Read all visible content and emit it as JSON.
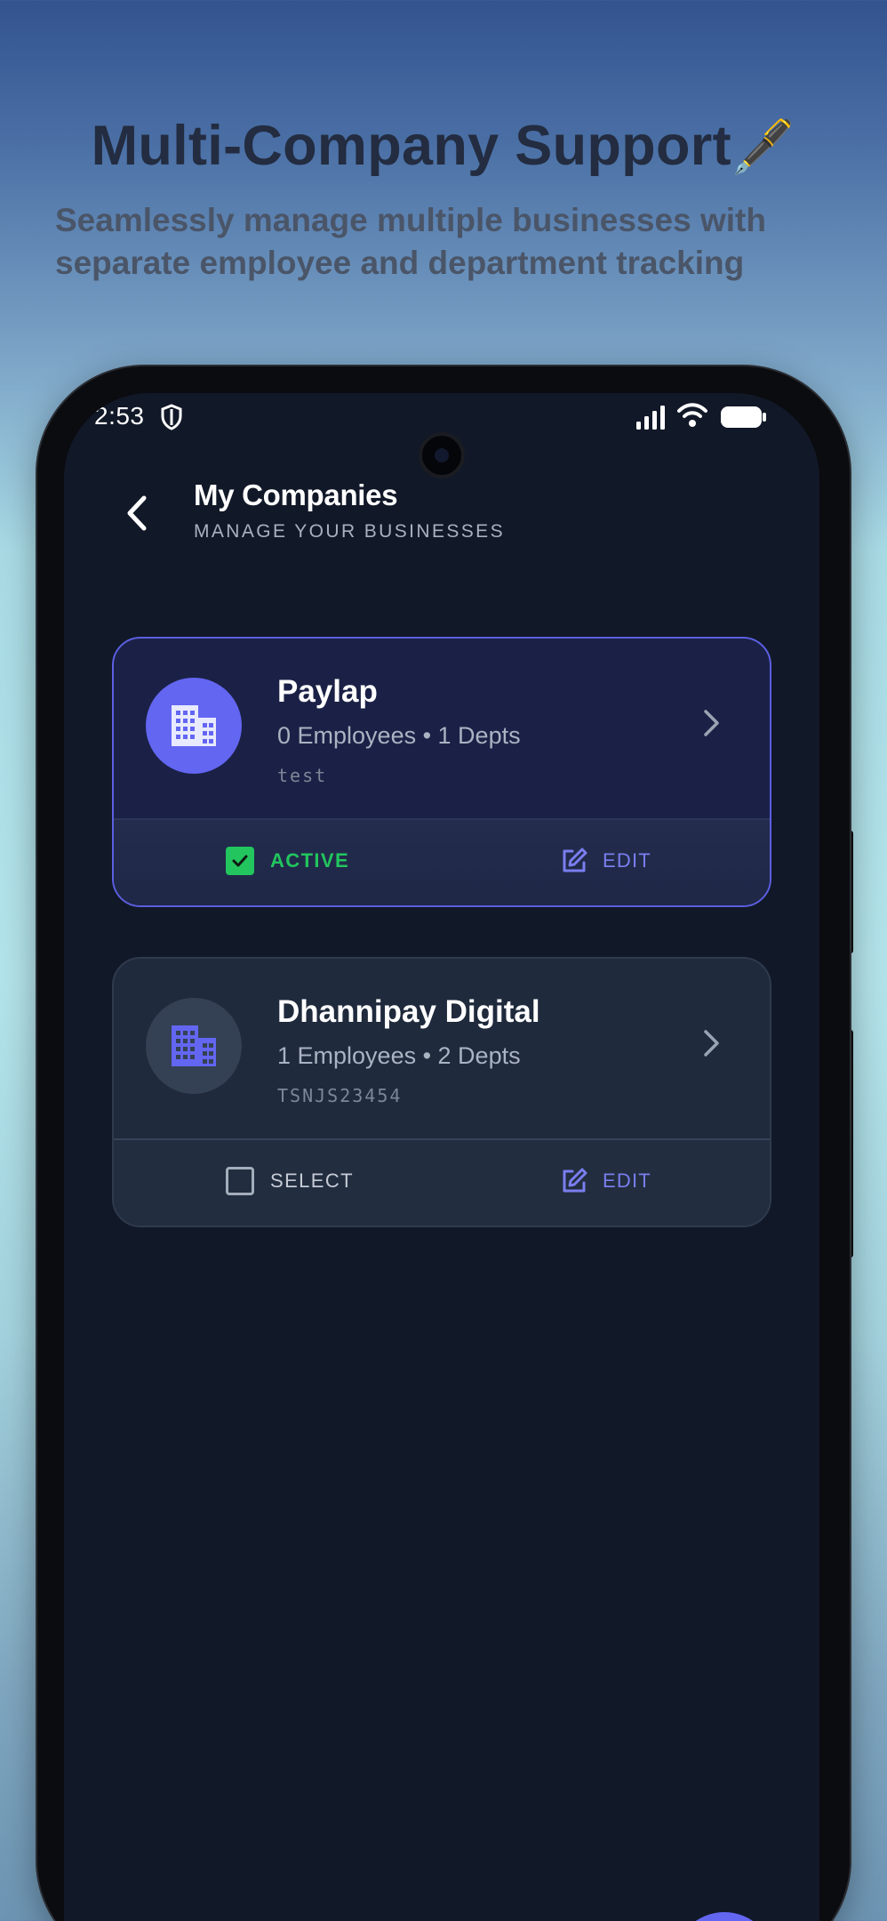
{
  "promo": {
    "headline": "Multi-Company Support",
    "headline_emoji": "🖋️",
    "subline": "Seamlessly manage multiple businesses with separate employee and department tracking"
  },
  "statusbar": {
    "time": "2:53",
    "icons": [
      "shield-icon",
      "signal-icon",
      "wifi-icon",
      "battery-icon"
    ]
  },
  "header": {
    "title": "My Companies",
    "subtitle": "MANAGE YOUR BUSINESSES"
  },
  "companies": [
    {
      "name": "Paylap",
      "meta": "0 Employees • 1 Depts",
      "code": "test",
      "status_label": "ACTIVE",
      "selected": true,
      "edit_label": "EDIT"
    },
    {
      "name": "Dhannipay Digital",
      "meta": "1 Employees • 2 Depts",
      "code": "TSNJS23454",
      "status_label": "SELECT",
      "selected": false,
      "edit_label": "EDIT"
    }
  ],
  "colors": {
    "accent": "#6366f1",
    "active_green": "#22c55e",
    "screen_bg": "#111828"
  }
}
